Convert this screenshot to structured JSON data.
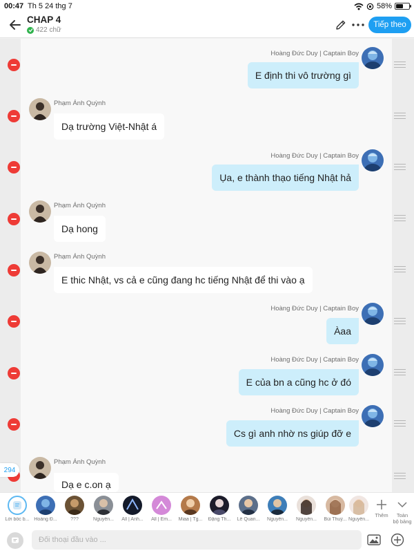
{
  "status_bar": {
    "time": "00:47",
    "date": "Th 5 24 thg 7",
    "battery": "58%",
    "battery_level": 0.58
  },
  "header": {
    "title": "CHAP 4",
    "word_count": "422 chữ",
    "continue_label": "Tiếp theo"
  },
  "colors": {
    "accent": "#1e9ff2",
    "right_bubble": "#cdeefb",
    "left_bubble": "#ffffff",
    "delete": "#ee3b36",
    "check": "#2fb24c"
  },
  "messages": [
    {
      "side": "right",
      "name": "Hoàng Đức Duy | Captain Boy",
      "text": "E định thi vô trường gì"
    },
    {
      "side": "left",
      "name": "Phạm Ánh Quỳnh",
      "text": "Dạ trường Việt-Nhật á"
    },
    {
      "side": "right",
      "name": "Hoàng Đức Duy | Captain Boy",
      "text": "Ụa, e thành thạo tiếng Nhật hả"
    },
    {
      "side": "left",
      "name": "Phạm Ánh Quỳnh",
      "text": "Dạ hong"
    },
    {
      "side": "left",
      "name": "Phạm Ánh Quỳnh",
      "text": "E thic Nhật, vs cả e cũng đang hc tiếng Nhật để thi vào ạ"
    },
    {
      "side": "right",
      "name": "Hoàng Đức Duy | Captain Boy",
      "text": "Àaa"
    },
    {
      "side": "right",
      "name": "Hoàng Đức Duy | Captain Boy",
      "text": "E của bn a cũng hc ở đó"
    },
    {
      "side": "right",
      "name": "Hoàng Đức Duy | Captain Boy",
      "text": "Cs gì anh nhờ ns giúp đỡ e"
    },
    {
      "side": "left",
      "name": "Phạm Ánh Quỳnh",
      "text": "Dạ e c.on ạ"
    }
  ],
  "counter": "294",
  "characters": [
    {
      "name": "Lời bốc b...",
      "icon": "narration-icon"
    },
    {
      "name": "Hoàng Đ..."
    },
    {
      "name": "???"
    },
    {
      "name": "Nguyễn..."
    },
    {
      "name": "All | Anh..."
    },
    {
      "name": "All | Em..."
    },
    {
      "name": "Miaa | Tg..."
    },
    {
      "name": "Đặng Th..."
    },
    {
      "name": "Lê Quan..."
    },
    {
      "name": "Nguyễn..."
    },
    {
      "name": "Nguyễn..."
    },
    {
      "name": "Bùi Thuỳ..."
    },
    {
      "name": "Nguyễn..."
    }
  ],
  "char_bar": {
    "add_label": "Thêm",
    "all_label_1": "Toàn",
    "all_label_2": "bộ bảng"
  },
  "input": {
    "placeholder": "Đối thoại đầu vào ..."
  }
}
